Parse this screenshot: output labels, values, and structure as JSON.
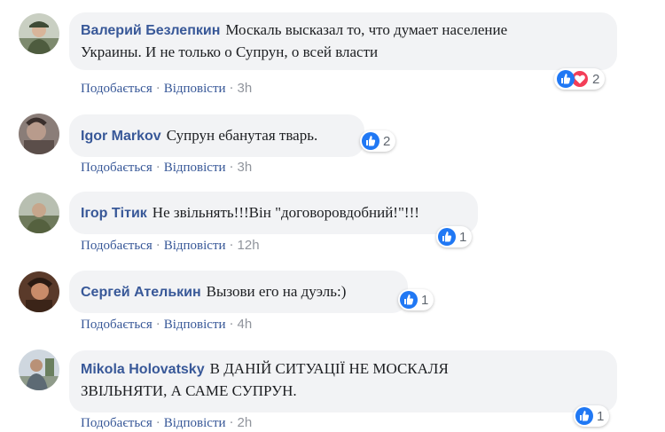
{
  "actions": {
    "like": "Подобається",
    "reply": "Відповісти",
    "sep": "·"
  },
  "comments": [
    {
      "author": "Валерий Безлепкин",
      "text_line1": "Москаль высказал то, что думает население",
      "text_line2": "Украины. И не только о Супрун, о всей власти",
      "time": "3h",
      "reaction_count": "2"
    },
    {
      "author": "Igor Markov",
      "text": "Супрун ебанутая тварь.",
      "time": "3h",
      "reaction_count": "2"
    },
    {
      "author": "Ігор Тітик",
      "text": "Не звільнять!!!Він \"договоровдобний!\"!!!",
      "time": "12h",
      "reaction_count": "1"
    },
    {
      "author": "Сергей Ателькин",
      "text": "Вызови его на дуэль:)",
      "time": "4h",
      "reaction_count": "1"
    },
    {
      "author": "Mikola Holovatsky",
      "text_line1": "В ДАНІЙ СИТУАЦІЇ НЕ МОСКАЛЯ",
      "text_line2": "ЗВІЛЬНЯТИ, А САМЕ СУПРУН.",
      "time": "2h",
      "reaction_count": "1"
    }
  ],
  "colors": {
    "author": "#385898",
    "bubble": "#f2f3f5",
    "like_blue": "#2078f4",
    "love_red": "#f33e58"
  },
  "icons": {
    "like": "thumbs-up-icon",
    "love": "heart-icon"
  }
}
